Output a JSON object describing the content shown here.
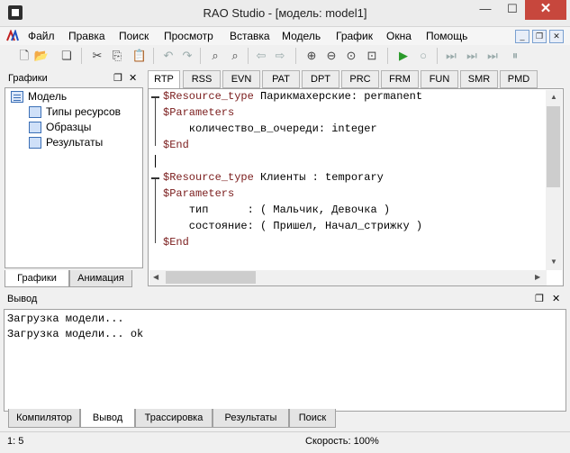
{
  "window": {
    "title": "RAO Studio - [модель: model1]",
    "min": "—",
    "max": "☐",
    "close": "✕"
  },
  "menu": {
    "items": [
      "Файл",
      "Правка",
      "Поиск",
      "Просмотр",
      "Вставка",
      "Модель",
      "График",
      "Окна",
      "Помощь"
    ]
  },
  "toolbar": {
    "icons": [
      "new-file-icon",
      "open-icon",
      "save-all-icon",
      "cut-icon",
      "copy-icon",
      "paste-icon",
      "undo-icon",
      "redo-icon",
      "find-icon",
      "find-replace-icon",
      "back-icon",
      "forward-icon",
      "zoom-in-icon",
      "zoom-out-icon",
      "zoom-reset-icon",
      "zoom-fit-icon",
      "run-icon",
      "stop-icon",
      "step-icon",
      "step-fast-icon",
      "step-more-icon",
      "pause-icon"
    ]
  },
  "left_panel": {
    "title": "Графики",
    "tree": [
      {
        "label": "Модель",
        "indent": 0
      },
      {
        "label": "Типы ресурсов",
        "indent": 1
      },
      {
        "label": "Образцы",
        "indent": 1
      },
      {
        "label": "Результаты",
        "indent": 1
      }
    ],
    "tabs": [
      "Графики",
      "Анимация"
    ]
  },
  "editor": {
    "tabs": [
      "RTP",
      "RSS",
      "EVN",
      "PAT",
      "DPT",
      "PRC",
      "FRM",
      "FUN",
      "SMR",
      "PMD"
    ],
    "active_tab": "RTP",
    "lines": [
      {
        "kw": "$Resource_type",
        "rest": " Парикмахерские: permanent"
      },
      {
        "kw": "$Parameters",
        "rest": ""
      },
      {
        "kw": "",
        "rest": "    количество_в_очереди: integer"
      },
      {
        "kw": "$End",
        "rest": ""
      },
      {
        "kw": "",
        "rest": ""
      },
      {
        "kw": "$Resource_type",
        "rest": " Клиенты : temporary"
      },
      {
        "kw": "$Parameters",
        "rest": ""
      },
      {
        "kw": "",
        "rest": "    тип      : ( Мальчик, Девочка )"
      },
      {
        "kw": "",
        "rest": "    состояние: ( Пришел, Начал_стрижку )"
      },
      {
        "kw": "$End",
        "rest": ""
      }
    ]
  },
  "output": {
    "title": "Вывод",
    "lines": [
      "Загрузка модели...",
      "Загрузка модели... ok"
    ],
    "tabs": [
      "Компилятор",
      "Вывод",
      "Трассировка",
      "Результаты",
      "Поиск"
    ],
    "active_tab": "Вывод"
  },
  "status": {
    "position": "1: 5",
    "speed": "Скорость: 100%"
  },
  "colors": {
    "keyword": "#7a1c1c",
    "close_button": "#c7473d",
    "run_icon": "#2a9a2a"
  }
}
